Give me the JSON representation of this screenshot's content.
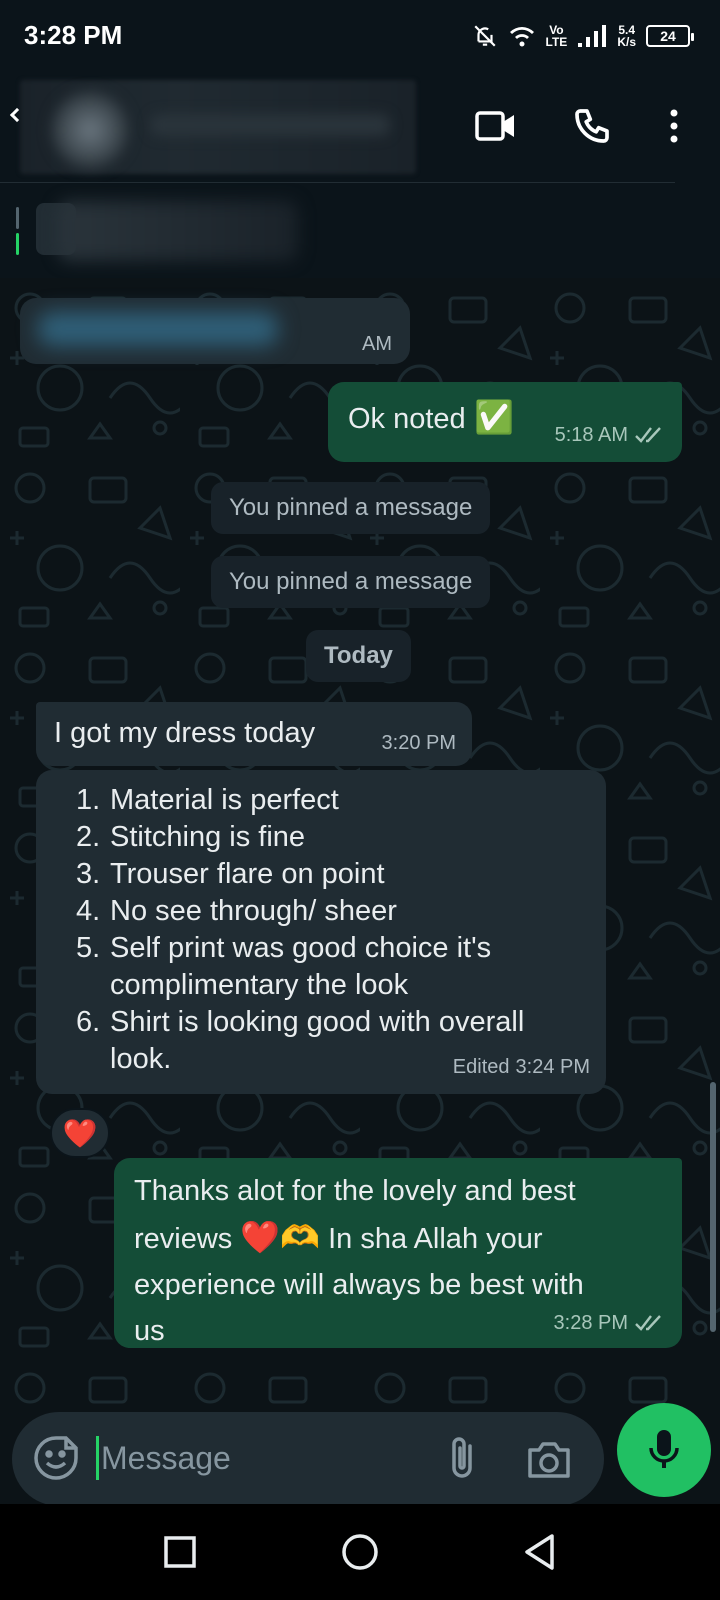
{
  "status_bar": {
    "time": "3:28 PM",
    "volte_top": "Vo",
    "volte_bottom": "LTE",
    "speed_value": "5.4",
    "speed_unit": "K/s",
    "battery": "24",
    "icons": [
      "bell-off-icon",
      "wifi-icon",
      "signal-icon"
    ]
  },
  "header": {
    "icons": [
      "back-arrow-icon",
      "video-call-icon",
      "voice-call-icon",
      "more-vert-icon"
    ]
  },
  "messages": {
    "blurred_time": "AM",
    "ok_noted": {
      "text": "Ok noted",
      "emoji": "✅",
      "time": "5:18 AM",
      "status": "read"
    },
    "system_pinned_1": "You pinned a message",
    "system_pinned_2": "You pinned a message",
    "date_divider": "Today",
    "dress_msg": {
      "text": "I got my dress today",
      "time": "3:20 PM"
    },
    "review": {
      "items": [
        {
          "num": "1.",
          "lines": [
            "Material is perfect"
          ]
        },
        {
          "num": "2.",
          "lines": [
            "Stitching is fine"
          ]
        },
        {
          "num": "3.",
          "lines": [
            "Trouser flare on point"
          ]
        },
        {
          "num": "4.",
          "lines": [
            "No see through/ sheer"
          ]
        },
        {
          "num": "5.",
          "lines": [
            "Self print was good choice it's",
            "complimentary the look"
          ]
        },
        {
          "num": "6.",
          "lines": [
            "Shirt is looking good with overall",
            "look."
          ]
        }
      ],
      "edited": "Edited",
      "time": "3:24 PM",
      "reaction": "❤️"
    },
    "thanks_msg": {
      "line1": "Thanks alot for the lovely and best",
      "line2_a": "reviews",
      "line2_emoji": "❤️🫶",
      "line2_b": "In sha Allah your",
      "line3": "experience will always be best with",
      "line4": "us",
      "time": "3:28 PM",
      "status": "read"
    }
  },
  "input": {
    "placeholder": "Message",
    "icons": [
      "sticker-icon",
      "attach-icon",
      "camera-icon",
      "mic-icon"
    ]
  },
  "nav": {
    "icons": [
      "recents-icon",
      "home-icon",
      "back-icon"
    ]
  },
  "colors": {
    "outgoing_bubble": "#144d37",
    "incoming_bubble": "#202c33",
    "accent": "#21c063",
    "read_ticks": "#a8c7bb"
  }
}
